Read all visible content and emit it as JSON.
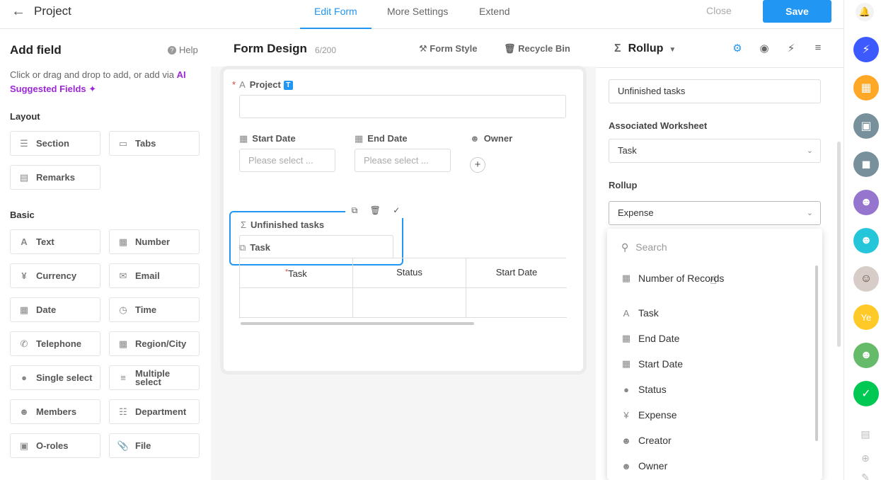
{
  "topbar": {
    "back_icon": "arrow-left-icon",
    "title": "Project",
    "tabs": [
      "Edit Form",
      "More Settings",
      "Extend"
    ],
    "close_label": "Close",
    "save_label": "Save"
  },
  "left": {
    "title": "Add field",
    "help_label": "Help",
    "hint_text": "Click or drag and drop to add, or add via ",
    "hint_ai": "AI Suggested Fields",
    "sections": {
      "layout": "Layout",
      "basic": "Basic"
    },
    "layout_items": [
      "Section",
      "Tabs",
      "Remarks"
    ],
    "basic_items": [
      "Text",
      "Number",
      "Currency",
      "Email",
      "Date",
      "Time",
      "Telephone",
      "Region/City",
      "Single select",
      "Multiple select",
      "Members",
      "Department",
      "O-roles",
      "File"
    ]
  },
  "center": {
    "title": "Form Design",
    "count": "6/200",
    "form_style_label": "Form Style",
    "recycle_label": "Recycle Bin",
    "fields": {
      "project": "Project",
      "project_badge": "T",
      "start_date": "Start Date",
      "end_date": "End Date",
      "owner": "Owner",
      "date_placeholder": "Please select ...",
      "unfinished": "Unfinished tasks",
      "task": "Task"
    },
    "table_headers": [
      "Task",
      "Status",
      "Start Date"
    ]
  },
  "right": {
    "title": "Rollup",
    "name_value": "Unfinished tasks",
    "assoc_label": "Associated Worksheet",
    "assoc_value": "Task",
    "rollup_label": "Rollup",
    "rollup_value": "Expense",
    "search_placeholder": "Search",
    "options": [
      "Number of Records",
      "Task",
      "End Date",
      "Start Date",
      "Status",
      "Expense",
      "Creator",
      "Owner"
    ]
  },
  "rail": {
    "avatar_initials": "Ye",
    "colors": {
      "accent": "#2196f3",
      "app1": "#3d5afe",
      "app2": "#ffa726",
      "app3": "#78909c",
      "app4": "#9575cd",
      "app5": "#26c6da",
      "app6": "#ffca28",
      "app7": "#66bb6a",
      "app8": "#00c853"
    }
  }
}
